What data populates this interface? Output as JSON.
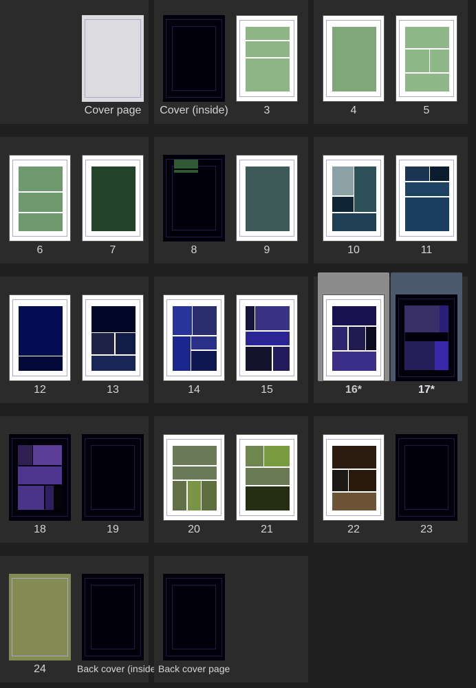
{
  "spreads": [
    {
      "row": 0,
      "col": 0,
      "pages": [
        null,
        {
          "label": "Cover page",
          "paper": "gray",
          "layout": "none",
          "colors": []
        }
      ]
    },
    {
      "row": 0,
      "col": 1,
      "pages": [
        {
          "label": "Cover (inside)",
          "paper": "black",
          "layout": "none",
          "colors": []
        },
        {
          "label": "3",
          "paper": "white",
          "layout": "p3",
          "colors": [
            "#8db585",
            "#8db585",
            "#8db585"
          ]
        }
      ]
    },
    {
      "row": 0,
      "col": 2,
      "pages": [
        {
          "label": "4",
          "paper": "white",
          "layout": "full",
          "colors": [
            "#7fa77a"
          ]
        },
        {
          "label": "5",
          "paper": "white",
          "layout": "p5",
          "colors": [
            "#8fb888",
            "#8fb888",
            "#8fb888",
            "#8fb888"
          ]
        }
      ]
    },
    {
      "row": 1,
      "col": 0,
      "pages": [
        {
          "label": "6",
          "paper": "white",
          "layout": "p6",
          "colors": [
            "#6f9a70",
            "#6f9a70",
            "#6f9a70"
          ]
        },
        {
          "label": "7",
          "paper": "white",
          "layout": "full",
          "colors": [
            "#23432a"
          ]
        }
      ]
    },
    {
      "row": 1,
      "col": 1,
      "pages": [
        {
          "label": "8",
          "paper": "black",
          "layout": "p8",
          "colors": [
            "#2f5a34",
            "#2f5a34"
          ]
        },
        {
          "label": "9",
          "paper": "white",
          "layout": "full",
          "colors": [
            "#3e5a58"
          ]
        }
      ]
    },
    {
      "row": 1,
      "col": 2,
      "pages": [
        {
          "label": "10",
          "paper": "white",
          "layout": "p10",
          "colors": [
            "#8da2a6",
            "#2e5058",
            "#0f2536",
            "#1f3f55"
          ]
        },
        {
          "label": "11",
          "paper": "white",
          "layout": "p11",
          "colors": [
            "#1c3552",
            "#0b1c2e",
            "#1d4262",
            "#1a3e5e"
          ]
        }
      ]
    },
    {
      "row": 2,
      "col": 0,
      "pages": [
        {
          "label": "12",
          "paper": "white",
          "layout": "p12",
          "colors": [
            "#050d52",
            "#030a3a"
          ]
        },
        {
          "label": "13",
          "paper": "white",
          "layout": "p13",
          "colors": [
            "#020828",
            "#1c2346",
            "#121c46",
            "#1a2558"
          ]
        }
      ]
    },
    {
      "row": 2,
      "col": 1,
      "pages": [
        {
          "label": "14",
          "paper": "white",
          "layout": "p14",
          "colors": [
            "#28349a",
            "#2a2e6e",
            "#1c2690",
            "#2a2f88",
            "#101650"
          ]
        },
        {
          "label": "15",
          "paper": "white",
          "layout": "p15",
          "colors": [
            "#14143e",
            "#3a3284",
            "#2a2494",
            "#14142c",
            "#221c5e"
          ]
        }
      ]
    },
    {
      "row": 2,
      "col": 2,
      "pages": [
        {
          "label": "16*",
          "paper": "white",
          "layout": "p16",
          "colors": [
            "#181250",
            "#2e2670",
            "#211b52",
            "#0d0b24",
            "#3a2e88"
          ],
          "selected": "primary"
        },
        {
          "label": "17*",
          "paper": "black",
          "layout": "p17",
          "colors": [
            "#3a3068",
            "#2a1e78",
            "#261e58",
            "#3a26a8"
          ],
          "selected": "secondary"
        }
      ]
    },
    {
      "row": 3,
      "col": 0,
      "pages": [
        {
          "label": "18",
          "paper": "black",
          "layout": "p18",
          "colors": [
            "#2e2050",
            "#5a3e98",
            "#4e3690",
            "#4a3488",
            "#2e2060",
            "#050308"
          ]
        },
        {
          "label": "19",
          "paper": "black",
          "layout": "none",
          "colors": []
        }
      ]
    },
    {
      "row": 3,
      "col": 1,
      "pages": [
        {
          "label": "20",
          "paper": "white",
          "layout": "p20",
          "colors": [
            "#6b7a58",
            "#6b7a58",
            "#627048",
            "#7a9448",
            "#5e6e3e"
          ]
        },
        {
          "label": "21",
          "paper": "white",
          "layout": "p21",
          "colors": [
            "#6e8650",
            "#7a9a40",
            "#6a7a56",
            "#252e12"
          ]
        }
      ]
    },
    {
      "row": 3,
      "col": 2,
      "pages": [
        {
          "label": "22",
          "paper": "white",
          "layout": "p22",
          "colors": [
            "#2c1c10",
            "#1c1814",
            "#2a1a0c",
            "#6e5436"
          ]
        },
        {
          "label": "23",
          "paper": "black",
          "layout": "none",
          "colors": []
        }
      ]
    },
    {
      "row": 4,
      "col": 0,
      "pages": [
        {
          "label": "24",
          "paper": "olive",
          "layout": "none",
          "colors": []
        },
        {
          "label": "Back cover (inside)",
          "paper": "black",
          "layout": "none",
          "colors": []
        }
      ]
    },
    {
      "row": 4,
      "col": 1,
      "pages": [
        {
          "label": "Back cover page",
          "paper": "black",
          "layout": "none",
          "colors": []
        },
        null
      ]
    }
  ],
  "colors": {
    "background": "#1f1f1f",
    "spread": "#2b2b2b",
    "selected_primary": "#8c8c8c",
    "selected_secondary": "#4c586c"
  }
}
